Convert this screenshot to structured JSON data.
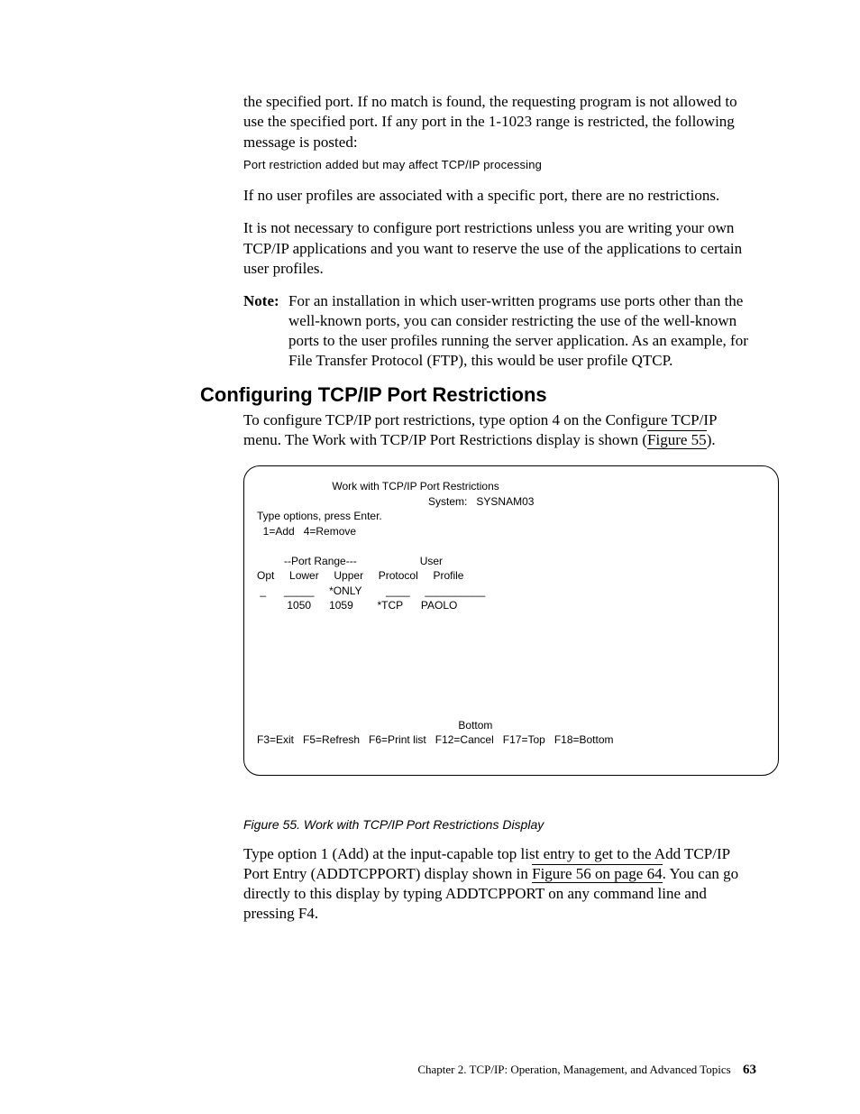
{
  "intro": {
    "p1": "the specified port. If no match is found, the requesting program is not allowed to use the specified port. If any port in the 1-1023 range is restricted, the following message is posted:",
    "code": "Port restriction added but may affect TCP/IP processing",
    "p2": "If no user profiles are associated with a specific port, there are no restrictions.",
    "p3": "It is not necessary to configure port restrictions unless you are writing your own TCP/IP applications and you want to reserve the use of the applications to certain user profiles.",
    "note_label": "Note:",
    "note_text": "For an installation in which user-written programs use ports other than the well-known ports, you can consider restricting the use of the well-known ports to the user profiles running the server application. As an example, for File Transfer Protocol (FTP), this would be user profile QTCP."
  },
  "section": {
    "heading": "Configuring TCP/IP Port Restrictions",
    "p_before_link": "To configure TCP/IP port restrictions, type option 4 on the Configure TCP/IP menu. The Work with TCP/IP Port Restrictions display is shown (",
    "link1": "Figure 55",
    "p_after_link": ")."
  },
  "terminal": {
    "title": "Work with TCP/IP Port Restrictions",
    "system_label": "System:",
    "system_name": "SYSNAM03",
    "instructions": "Type options, press Enter.",
    "options": "  1=Add   4=Remove",
    "header_portrange": "--Port Range---",
    "header_user": "User",
    "header_opt": "Opt",
    "header_lower": "Lower",
    "header_upper": "Upper",
    "header_protocol": "Protocol",
    "header_profile": "Profile",
    "row_blank_opt": "_",
    "row_blank_lower": "_____",
    "row_blank_upper": "*ONLY",
    "row_blank_protocol": "____",
    "row_blank_profile": "__________",
    "row1_lower": "1050",
    "row1_upper": "1059",
    "row1_protocol": "*TCP",
    "row1_profile": "PAOLO",
    "bottom_label": "Bottom",
    "fkeys": "F3=Exit   F5=Refresh   F6=Print list   F12=Cancel   F17=Top   F18=Bottom"
  },
  "figure": {
    "caption": "Figure 55. Work with TCP/IP Port Restrictions Display"
  },
  "post": {
    "before_link": "Type option 1 (Add) at the input-capable top list entry to get to the Add TCP/IP Port Entry (ADDTCPPORT) display shown in ",
    "link2": "Figure 56 on page 64",
    "after_link": ". You can go directly to this display by typing ADDTCPPORT on any command line and pressing F4."
  },
  "footer": {
    "chapter": "Chapter 2. TCP/IP: Operation, Management, and Advanced Topics",
    "page": "63"
  }
}
